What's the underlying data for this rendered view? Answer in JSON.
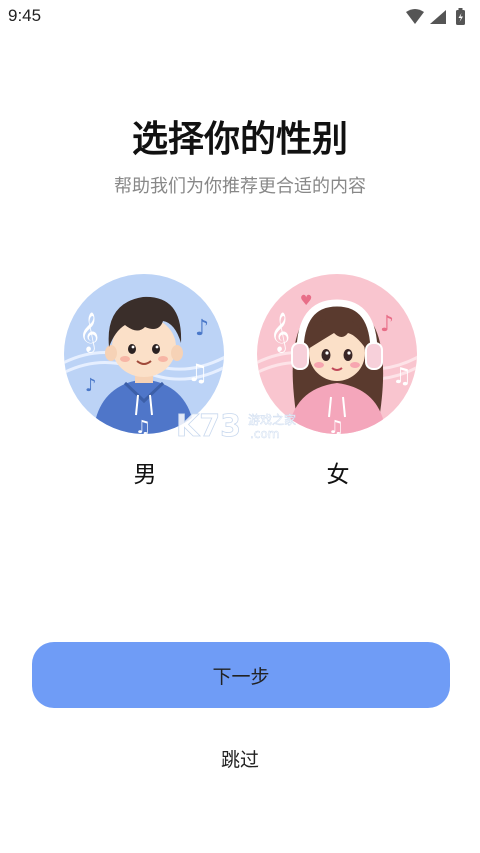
{
  "status_bar": {
    "time": "9:45",
    "icons": [
      "wifi-icon",
      "signal-icon",
      "battery-charging-icon"
    ]
  },
  "header": {
    "title": "选择你的性别",
    "subtitle": "帮助我们为你推荐更合适的内容"
  },
  "gender_options": [
    {
      "label": "男",
      "avatar": "boy-avatar-icon",
      "bg_color": "#bcd3f6"
    },
    {
      "label": "女",
      "avatar": "girl-avatar-icon",
      "bg_color": "#f9c5cf"
    }
  ],
  "watermark": {
    "text": "K73",
    "sub_text": "游戏之家",
    "domain": ".com"
  },
  "actions": {
    "next_label": "下一步",
    "skip_label": "跳过"
  },
  "colors": {
    "accent": "#6f9cf6",
    "subtitle": "#888888"
  }
}
